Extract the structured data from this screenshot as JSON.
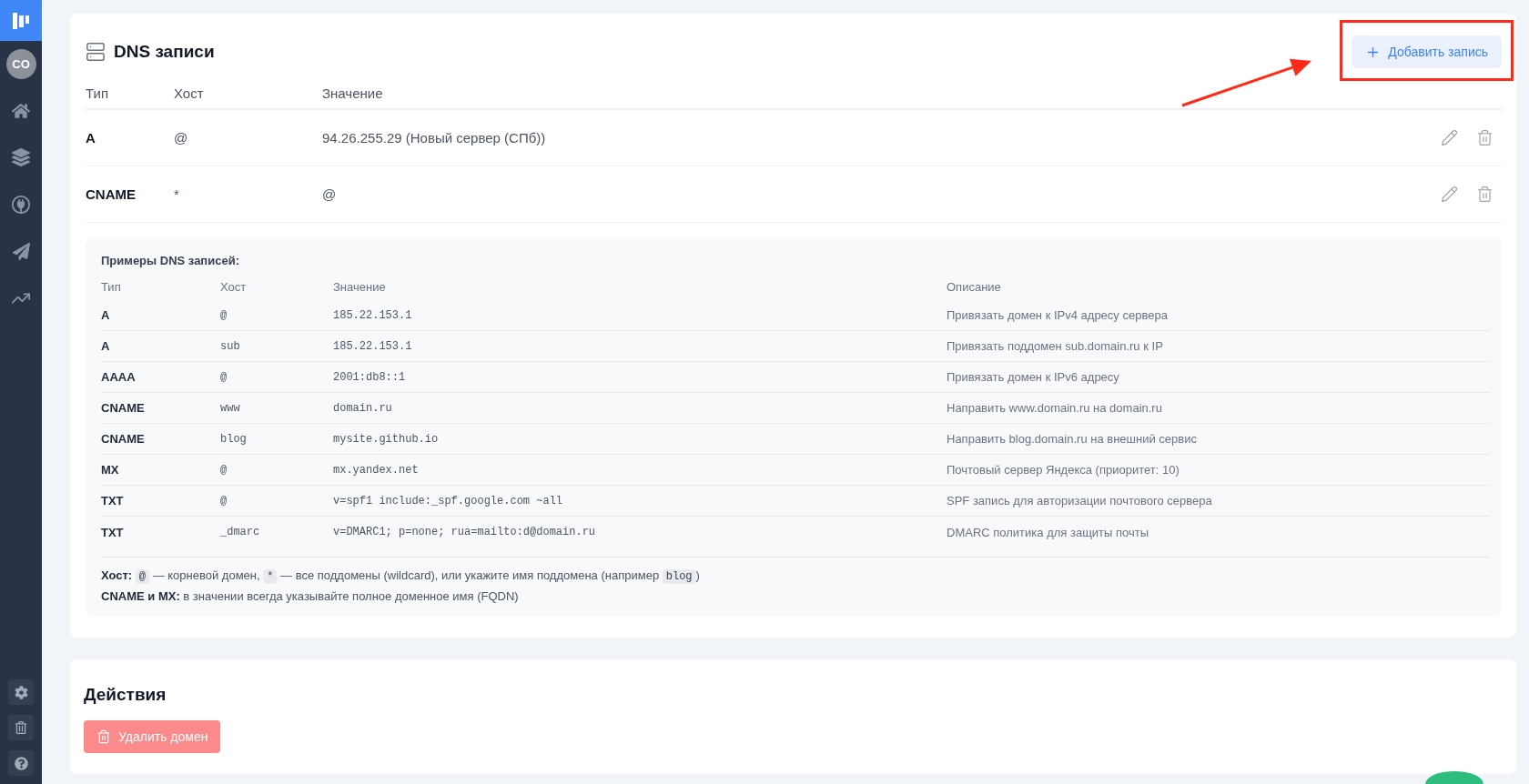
{
  "sidebar": {
    "avatar": "CO"
  },
  "dns": {
    "title": "DNS записи",
    "add_button": "Добавить запись",
    "columns": [
      "Тип",
      "Хост",
      "Значение"
    ],
    "records": [
      {
        "type": "A",
        "host": "@",
        "value": "94.26.255.29 (Новый сервер (СПб))"
      },
      {
        "type": "CNAME",
        "host": "*",
        "value": "@"
      }
    ],
    "examples": {
      "title": "Примеры DNS записей:",
      "columns": [
        "Тип",
        "Хост",
        "Значение",
        "Описание"
      ],
      "rows": [
        {
          "type": "A",
          "host": "@",
          "value": "185.22.153.1",
          "description": "Привязать домен к IPv4 адресу сервера"
        },
        {
          "type": "A",
          "host": "sub",
          "value": "185.22.153.1",
          "description": "Привязать поддомен sub.domain.ru к IP"
        },
        {
          "type": "AAAA",
          "host": "@",
          "value": "2001:db8::1",
          "description": "Привязать домен к IPv6 адресу"
        },
        {
          "type": "CNAME",
          "host": "www",
          "value": "domain.ru",
          "description": "Направить www.domain.ru на domain.ru"
        },
        {
          "type": "CNAME",
          "host": "blog",
          "value": "mysite.github.io",
          "description": "Направить blog.domain.ru на внешний сервис"
        },
        {
          "type": "MX",
          "host": "@",
          "value": "mx.yandex.net",
          "description": "Почтовый сервер Яндекса (приоритет: 10)"
        },
        {
          "type": "TXT",
          "host": "@",
          "value": "v=spf1 include:_spf.google.com ~all",
          "description": "SPF запись для авторизации почтового сервера"
        },
        {
          "type": "TXT",
          "host": "_dmarc",
          "value": "v=DMARC1; p=none; rua=mailto:d@domain.ru",
          "description": "DMARC политика для защиты почты"
        }
      ],
      "notes": [
        {
          "parts": [
            {
              "kind": "text",
              "text": "**Хост:** "
            },
            {
              "kind": "code",
              "text": "@"
            },
            {
              "kind": "text",
              "text": " — корневой домен, "
            },
            {
              "kind": "code",
              "text": "*"
            },
            {
              "kind": "text",
              "text": " — все поддомены (wildcard), или укажите имя поддомена (например "
            },
            {
              "kind": "code",
              "text": "blog"
            },
            {
              "kind": "text",
              "text": ")"
            }
          ]
        },
        {
          "parts": [
            {
              "kind": "text",
              "text": "**CNAME и MX:** в значении всегда указывайте полное доменное имя (FQDN)"
            }
          ]
        }
      ]
    }
  },
  "actions": {
    "title": "Действия",
    "delete_button": "Удалить домен"
  },
  "annotations": {
    "frame": true,
    "arrow": true
  }
}
